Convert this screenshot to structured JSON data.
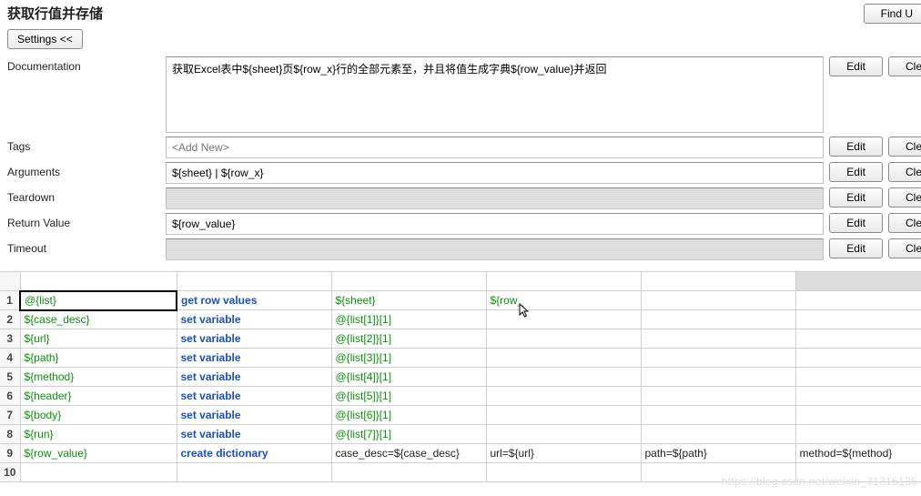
{
  "title": "获取行值并存储",
  "find_usages": "Find U",
  "settings_btn": "Settings <<",
  "labels": {
    "documentation": "Documentation",
    "tags": "Tags",
    "arguments": "Arguments",
    "teardown": "Teardown",
    "return_value": "Return Value",
    "timeout": "Timeout"
  },
  "values": {
    "documentation": "获取Excel表中${sheet}页${row_x}行的全部元素至，并且将值生成字典${row_value}并返回",
    "tags_placeholder": "<Add New>",
    "arguments": "${sheet} | ${row_x}",
    "teardown": "",
    "return_value": "${row_value}",
    "timeout": ""
  },
  "buttons": {
    "edit": "Edit",
    "clear": "Cle"
  },
  "grid_rows": [
    {
      "n": "1",
      "c1": "@{list}",
      "c2": "get row values",
      "c3": "${sheet}",
      "c4": "${row_",
      "c5": "",
      "c6": "",
      "s1": "green",
      "s2": "blue",
      "s3": "green",
      "s4": "green"
    },
    {
      "n": "2",
      "c1": "${case_desc}",
      "c2": "set variable",
      "c3": "@{list[1]}[1]",
      "c4": "",
      "c5": "",
      "c6": "",
      "s1": "green",
      "s2": "blue",
      "s3": "green"
    },
    {
      "n": "3",
      "c1": "${url}",
      "c2": "set variable",
      "c3": "@{list[2]}[1]",
      "c4": "",
      "c5": "",
      "c6": "",
      "s1": "green",
      "s2": "blue",
      "s3": "green"
    },
    {
      "n": "4",
      "c1": "${path}",
      "c2": "set variable",
      "c3": "@{list[3]}[1]",
      "c4": "",
      "c5": "",
      "c6": "",
      "s1": "green",
      "s2": "blue",
      "s3": "green"
    },
    {
      "n": "5",
      "c1": "${method}",
      "c2": "set variable",
      "c3": "@{list[4]}[1]",
      "c4": "",
      "c5": "",
      "c6": "",
      "s1": "green",
      "s2": "blue",
      "s3": "green"
    },
    {
      "n": "6",
      "c1": "${header}",
      "c2": "set variable",
      "c3": "@{list[5]}[1]",
      "c4": "",
      "c5": "",
      "c6": "",
      "s1": "green",
      "s2": "blue",
      "s3": "green"
    },
    {
      "n": "7",
      "c1": "${body}",
      "c2": "set variable",
      "c3": "@{list[6]}[1]",
      "c4": "",
      "c5": "",
      "c6": "",
      "s1": "green",
      "s2": "blue",
      "s3": "green"
    },
    {
      "n": "8",
      "c1": "${run}",
      "c2": "set variable",
      "c3": "@{list[7]}[1]",
      "c4": "",
      "c5": "",
      "c6": "",
      "s1": "green",
      "s2": "blue",
      "s3": "green"
    },
    {
      "n": "9",
      "c1": "${row_value}",
      "c2": "create dictionary",
      "c3": "case_desc=${case_desc}",
      "c4": "url=${url}",
      "c5": "path=${path}",
      "c6": "method=${method}",
      "s1": "green",
      "s2": "blue",
      "s3": "black",
      "s4": "black",
      "s5": "black",
      "s6": "black"
    },
    {
      "n": "10",
      "c1": "",
      "c2": "",
      "c3": "",
      "c4": "",
      "c5": "",
      "c6": ""
    }
  ],
  "watermark": "https://blog.csdn.net/weixin_31315135"
}
